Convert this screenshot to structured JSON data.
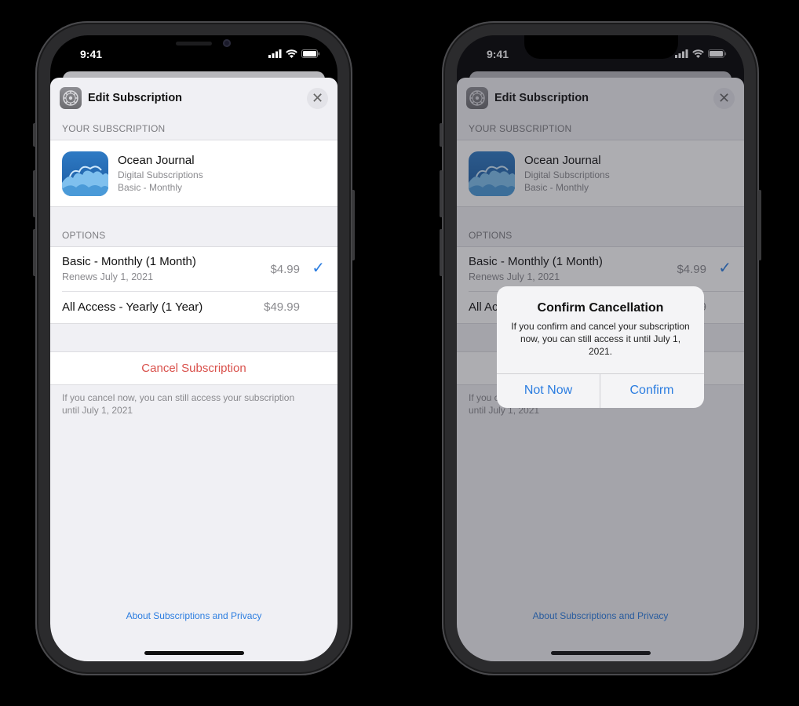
{
  "status": {
    "time": "9:41"
  },
  "sheet": {
    "title": "Edit Subscription",
    "close": "✕"
  },
  "subscription": {
    "section_label": "YOUR SUBSCRIPTION",
    "app_name": "Ocean Journal",
    "category": "Digital Subscriptions",
    "plan": "Basic - Monthly"
  },
  "options": {
    "section_label": "OPTIONS",
    "items": [
      {
        "title": "Basic - Monthly (1 Month)",
        "subtitle": "Renews July 1, 2021",
        "price": "$4.99",
        "selected": true
      },
      {
        "title": "All Access - Yearly (1 Year)",
        "price": "$49.99",
        "selected": false
      }
    ],
    "check": "✓"
  },
  "cancel": {
    "label": "Cancel Subscription",
    "footnote": "If you cancel now, you can still access your subscription until July 1, 2021"
  },
  "about_link": "About Subscriptions and Privacy",
  "alert": {
    "title": "Confirm Cancellation",
    "message": "If you confirm and cancel your subscription now, you can still access it until July 1, 2021.",
    "cancel_button": "Not Now",
    "confirm_button": "Confirm"
  },
  "colors": {
    "accent": "#2b7de0",
    "destructive": "#d9504b",
    "sheet_bg": "#f0f0f4"
  }
}
